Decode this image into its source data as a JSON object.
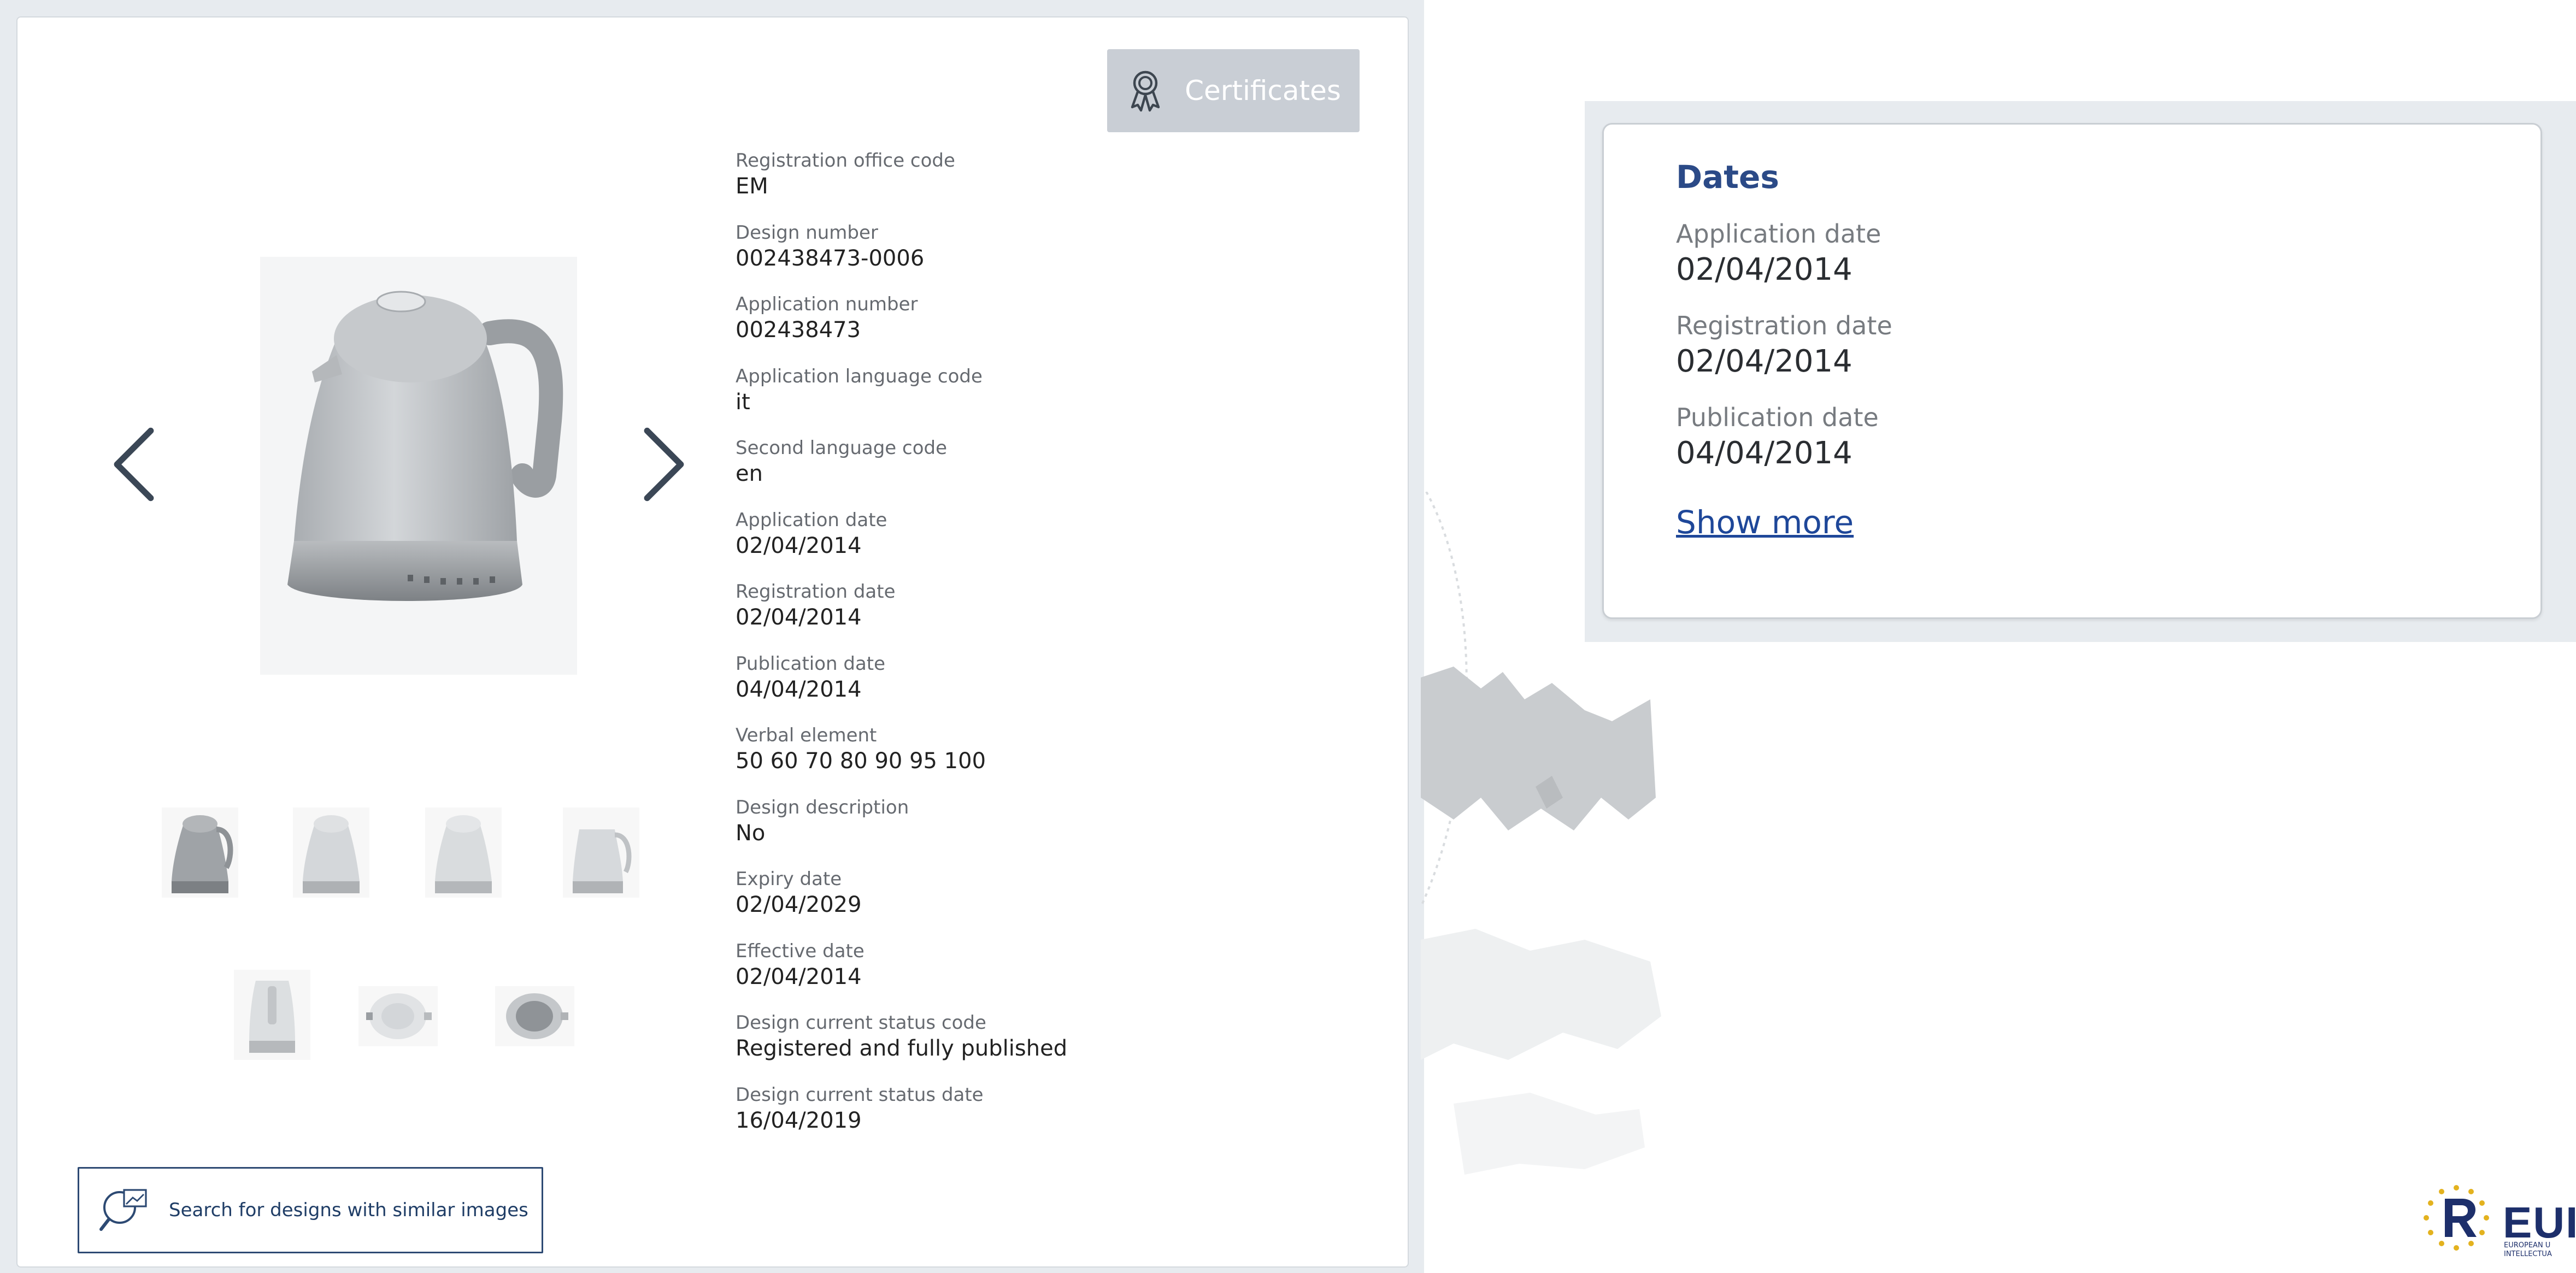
{
  "certificates": {
    "label": "Certificates",
    "icon": "award-icon"
  },
  "carousel": {
    "prev_icon": "chevron-left-icon",
    "next_icon": "chevron-right-icon",
    "main_image": "kettle-image",
    "thumbnail_count": 7
  },
  "meta": [
    {
      "label": "Registration office code",
      "value": "EM"
    },
    {
      "label": "Design number",
      "value": "002438473-0006"
    },
    {
      "label": "Application number",
      "value": "002438473"
    },
    {
      "label": "Application language code",
      "value": "it"
    },
    {
      "label": "Second language code",
      "value": "en"
    },
    {
      "label": "Application date",
      "value": "02/04/2014"
    },
    {
      "label": "Registration date",
      "value": "02/04/2014"
    },
    {
      "label": "Publication date",
      "value": "04/04/2014"
    },
    {
      "label": "Verbal element",
      "value": "50 60 70 80 90 95 100"
    },
    {
      "label": "Design description",
      "value": "No"
    },
    {
      "label": "Expiry date",
      "value": "02/04/2029"
    },
    {
      "label": "Effective date",
      "value": "02/04/2014"
    },
    {
      "label": "Design current status code",
      "value": "Registered and fully published"
    },
    {
      "label": "Design current status date",
      "value": "16/04/2019"
    }
  ],
  "similar_search": {
    "label": "Search for designs with similar images",
    "icon": "image-search-icon"
  },
  "dates_panel": {
    "title": "Dates",
    "items": [
      {
        "label": "Application date",
        "value": "02/04/2014"
      },
      {
        "label": "Registration date",
        "value": "02/04/2014"
      },
      {
        "label": "Publication date",
        "value": "04/04/2014"
      }
    ],
    "show_more": "Show more"
  },
  "logo": {
    "text": "EUI",
    "subtitle_1": "EUROPEAN U",
    "subtitle_2": "INTELLECTUA"
  },
  "colors": {
    "accent_blue": "#2b4a87",
    "link_blue": "#1e4799",
    "button_grey": "#c9ced5",
    "backdrop_grey": "#e7ebef"
  }
}
